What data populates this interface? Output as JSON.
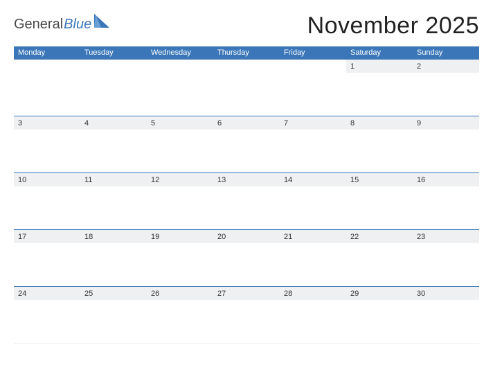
{
  "logo": {
    "word1": "General",
    "word2": "Blue"
  },
  "title": "November 2025",
  "day_headers": [
    "Monday",
    "Tuesday",
    "Wednesday",
    "Thursday",
    "Friday",
    "Saturday",
    "Sunday"
  ],
  "weeks": [
    [
      "",
      "",
      "",
      "",
      "",
      "1",
      "2"
    ],
    [
      "3",
      "4",
      "5",
      "6",
      "7",
      "8",
      "9"
    ],
    [
      "10",
      "11",
      "12",
      "13",
      "14",
      "15",
      "16"
    ],
    [
      "17",
      "18",
      "19",
      "20",
      "21",
      "22",
      "23"
    ],
    [
      "24",
      "25",
      "26",
      "27",
      "28",
      "29",
      "30"
    ]
  ],
  "colors": {
    "brand": "#3a76b8",
    "stripe": "#eef0f2"
  }
}
